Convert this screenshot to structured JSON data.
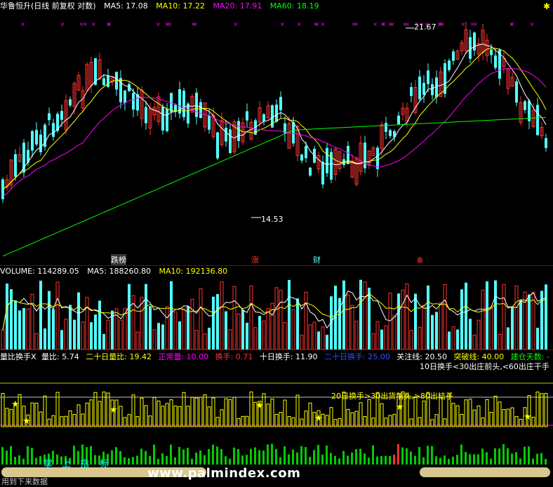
{
  "price_header": {
    "title": "华鲁恒升(日线 前复权 对数)",
    "ma5": "MA5: 17.08",
    "ma10": "MA10: 17.22",
    "ma20": "MA20: 17.91",
    "ma60": "MA60: 18.19"
  },
  "price_annotations": {
    "high_label": "21.67",
    "low_label": "14.53",
    "marker_1": "跌榜",
    "marker_2": "涨",
    "marker_3": "财",
    "marker_4": "备"
  },
  "volume_header": {
    "volume": "VOLUME: 114289.05",
    "ma5": "MA5: 188260.80",
    "ma10": "MA10: 192136.80"
  },
  "turnover_header": {
    "name": "量比换手X",
    "liangbi": "量比: 5.74",
    "twenty_liangbi": "二十日量比: 19.42",
    "normal": "正常量: 10.00",
    "turnover": "换手: 0.71",
    "ten_turnover": "十日换手: 11.90",
    "twenty_turnover": "二十日换手: 25.00",
    "focus_line": "关注线: 20.50",
    "break_line": "突破线: 40.00",
    "build_days": "建仓天数: -"
  },
  "turnover_notes": {
    "note1": "10日换手<30出庄前头,<60出庄干手",
    "note2": "20日换手>30出货前头,>80出桔子"
  },
  "bottom": {
    "label_zhang": "掌",
    "label_shang": "上",
    "label_zhi": "指",
    "label_biao": "标",
    "watermark": "www.palmindex.com",
    "footer": "用到下来数据"
  },
  "colors": {
    "up": "#ff3232",
    "down": "#54ffff",
    "ma5": "#ffffff",
    "ma10": "#ffff00",
    "ma20": "#ff00ff",
    "ma60": "#00ff00",
    "grid": "#8b0000"
  }
}
